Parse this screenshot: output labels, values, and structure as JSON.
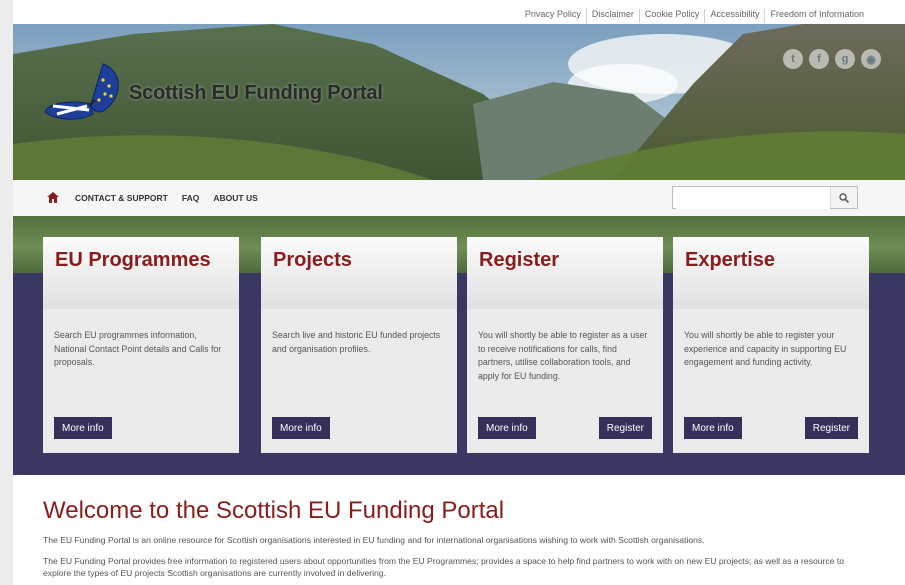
{
  "utility_links": [
    "Privacy Policy",
    "Disclaimer",
    "Cookie Policy",
    "Accessibility",
    "Freedom of Information"
  ],
  "header": {
    "site_title": "Scottish EU Funding Portal"
  },
  "social_icons": [
    "twitter-icon",
    "facebook-icon",
    "google-plus-icon",
    "rss-icon"
  ],
  "nav": {
    "links": [
      "CONTACT & SUPPORT",
      "FAQ",
      "ABOUT US"
    ],
    "search_placeholder": ""
  },
  "cards": [
    {
      "title": "EU Programmes",
      "text": "Search EU programmes information, National Contact Point details and Calls for proposals.",
      "more": "More info",
      "register": ""
    },
    {
      "title": "Projects",
      "text": "Search live and historic EU funded projects and organisation profiles.",
      "more": "More info",
      "register": ""
    },
    {
      "title": "Register",
      "text": "You will shortly be able to register as a user to receive notifications for calls, find partners, utilise collaboration tools,  and apply for EU funding.",
      "more": "More info",
      "register": "Register"
    },
    {
      "title": "Expertise",
      "text": "You will shortly be able to register your experience and capacity in supporting EU engagement and funding activity.",
      "more": "More info",
      "register": "Register"
    }
  ],
  "welcome": {
    "title": "Welcome to the Scottish EU Funding Portal",
    "p1": "The EU Funding Portal is an online resource for Scottish organisations interested in EU funding and for international organisations wishing to work with Scottish organisations.",
    "p2": "The EU Funding Portal provides free information to registered users about opportunities from the EU Programmes; provides a space to help find partners to work with on new EU projects; as well as a resource to explore the types of EU projects Scottish organisations are currently involved in delivering."
  },
  "colors": {
    "brand_red": "#8a1c1c",
    "band_purple": "#3b3763",
    "button_navy": "#34305a"
  }
}
